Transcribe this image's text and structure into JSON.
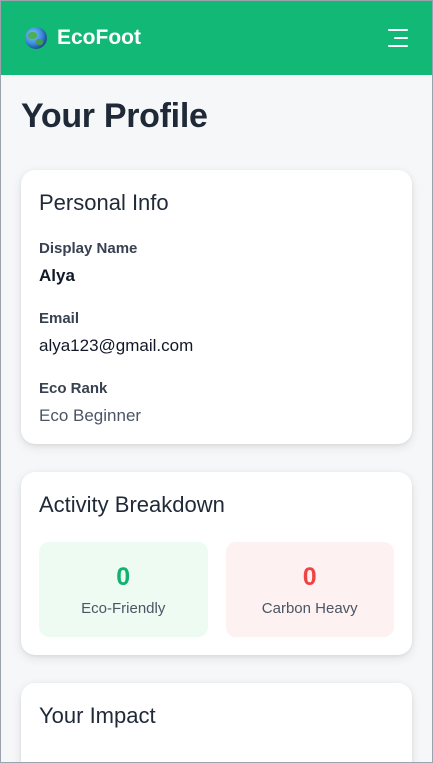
{
  "navbar": {
    "brand_name": "EcoFoot",
    "brand_icon": "globe-icon",
    "menu_icon": "hamburger-menu-icon",
    "color": "#12b876"
  },
  "page": {
    "title": "Your Profile"
  },
  "personal_info": {
    "title": "Personal Info",
    "fields": [
      {
        "label": "Display Name",
        "value": "Alya"
      },
      {
        "label": "Email",
        "value": "alya123@gmail.com"
      },
      {
        "label": "Eco Rank",
        "value": "Eco Beginner"
      }
    ]
  },
  "activity": {
    "title": "Activity Breakdown",
    "stats": [
      {
        "value": "0",
        "label": "Eco-Friendly",
        "color": "#10b26d"
      },
      {
        "value": "0",
        "label": "Carbon Heavy",
        "color": "#ef4444"
      }
    ]
  },
  "impact": {
    "title": "Your Impact"
  }
}
